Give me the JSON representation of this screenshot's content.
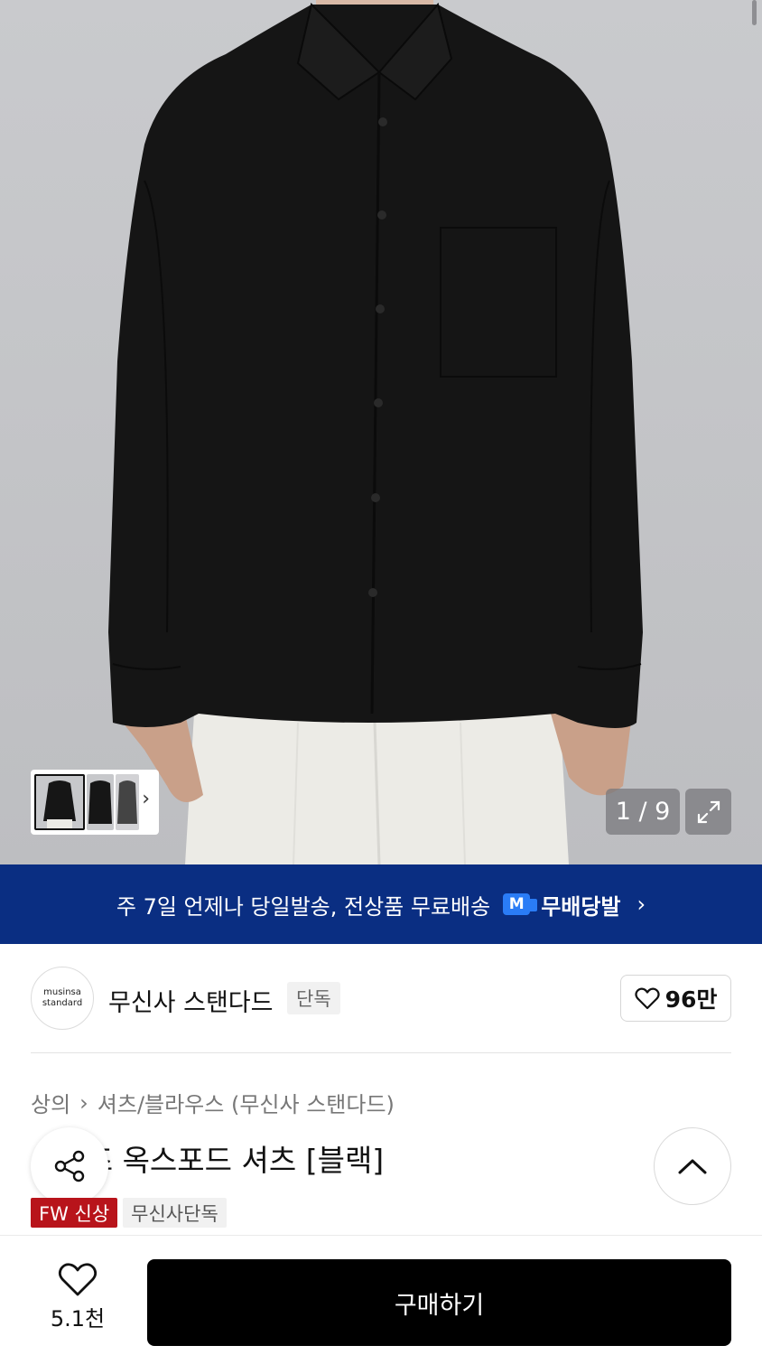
{
  "gallery": {
    "counter": "1 / 9",
    "thumbnail_count": 3,
    "icons": {
      "next": "chevron-right-icon",
      "expand": "expand-icon"
    }
  },
  "banner": {
    "text": "주 7일 언제나 당일발송, 전상품 무료배송",
    "badge_letter": "M",
    "badge_label": "무배당발"
  },
  "brand": {
    "logo_line1": "musinsa",
    "logo_line2": "standard",
    "name": "무신사 스탠다드",
    "exclusive": "단독",
    "likes": "96만"
  },
  "breadcrumb": {
    "category": "상의",
    "subcategory": "셔츠/블라우스 (무신사 스탠다드)"
  },
  "product": {
    "title": "ㅏ이즈 옥스포드 셔츠 [블랙]",
    "tags": [
      "FW 신상",
      "무신사단독"
    ]
  },
  "bottom_bar": {
    "wish_count": "5.1천",
    "buy_label": "구매하기"
  },
  "colors": {
    "banner_bg": "#0a2e82",
    "badge_blue": "#2a7cf6",
    "new_tag": "#b8141b",
    "buy_button": "#000000"
  }
}
